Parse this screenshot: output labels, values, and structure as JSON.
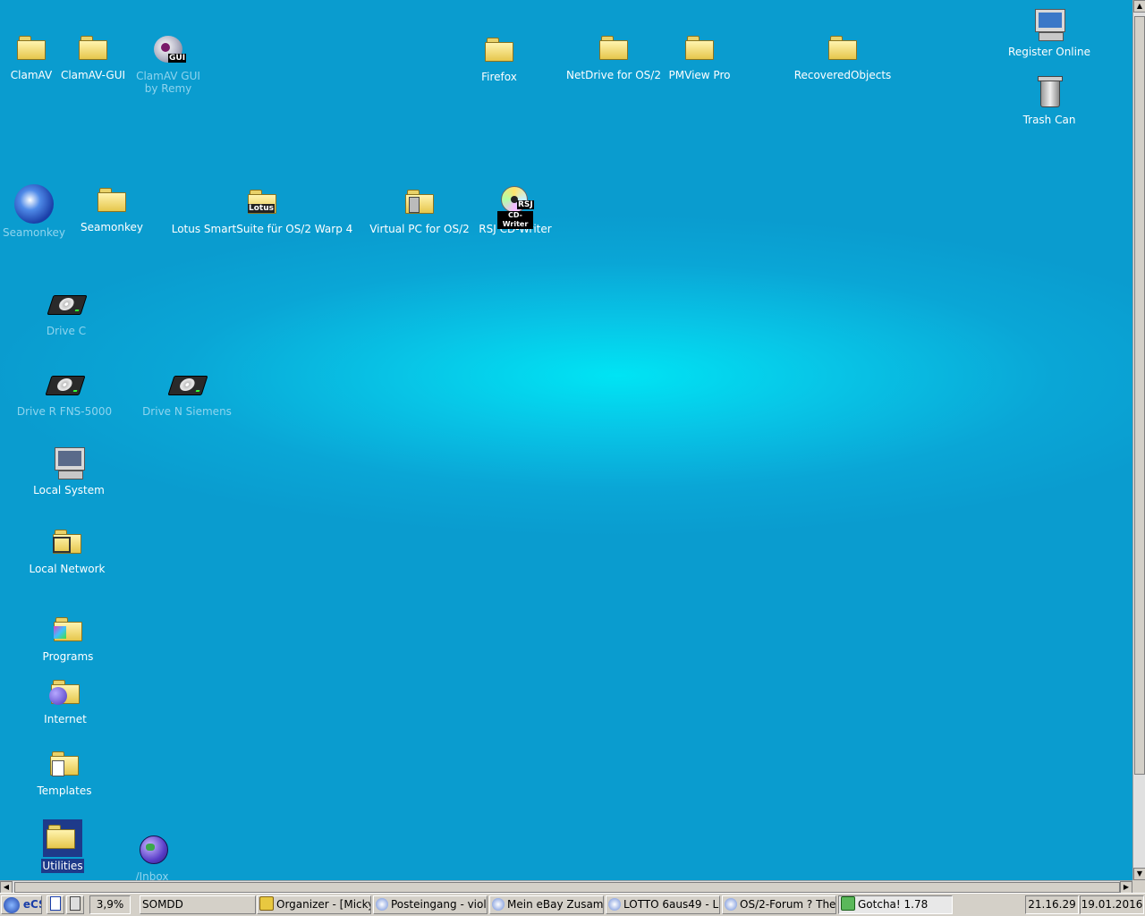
{
  "desktop": {
    "icons": {
      "clamav": "ClamAV",
      "clamav_gui": "ClamAV-GUI",
      "clamav_gui_remy_line1": "ClamAV GUI",
      "clamav_gui_remy_line2": "by Remy",
      "clamav_gui_badge": "GUI",
      "firefox": "Firefox",
      "netdrive": "NetDrive for OS/2",
      "pmview": "PMView Pro",
      "recovered": "RecoveredObjects",
      "register_online": "Register Online",
      "trash_can": "Trash Can",
      "seamonkey_program": "Seamonkey",
      "seamonkey_folder": "Seamonkey",
      "lotus": "Lotus SmartSuite für OS/2 Warp 4",
      "lotus_badge": "Lotus",
      "virtual_pc": "Virtual PC for OS/2",
      "rsj": "RSJ CD-Writer",
      "rsj_badge_line1": "RSJ",
      "rsj_badge_line2": "CD-Writer",
      "drive_c": "Drive C",
      "drive_r": "Drive R FNS-5000",
      "drive_n": "Drive N Siemens",
      "local_system": "Local System",
      "local_network": "Local Network",
      "programs": "Programs",
      "internet": "Internet",
      "templates": "Templates",
      "utilities": "Utilities",
      "inbox": "/Inbox"
    }
  },
  "taskbar": {
    "cpu": "3,9%",
    "items": [
      "SOMDD",
      "Organizer - [Micky",
      "Posteingang - viol",
      "Mein eBay Zusamm",
      "LOTTO 6aus49 - L",
      "OS/2-Forum ? The",
      "Gotcha! 1.78"
    ],
    "time": "21.16.29",
    "date": "19.01.2016"
  },
  "colors": {
    "desktop_center": "#00e4f4",
    "desktop_edge": "#0a9ccf",
    "taskbar_bg": "#d4d0c8"
  }
}
